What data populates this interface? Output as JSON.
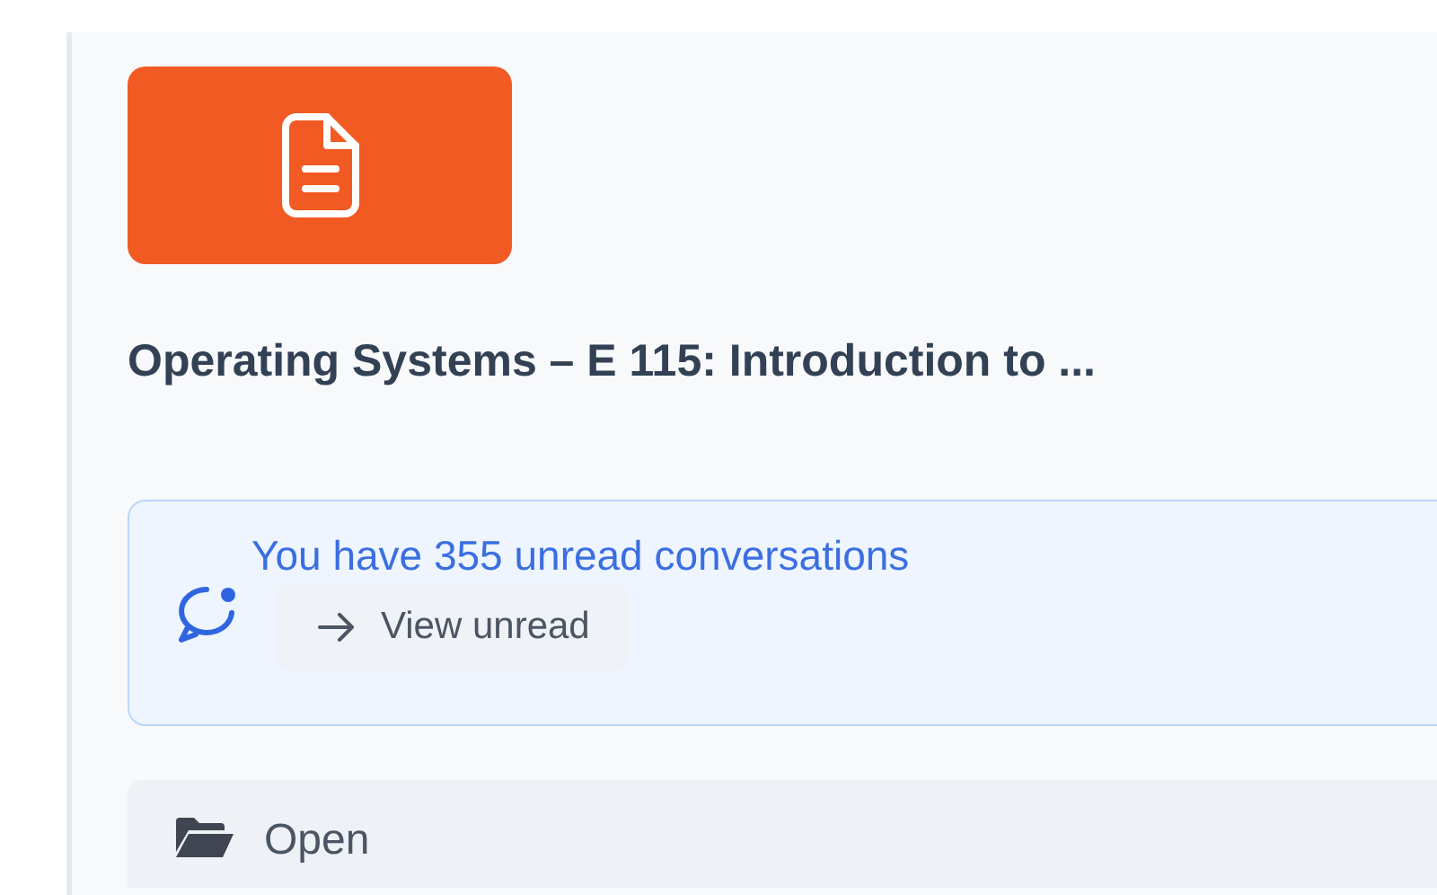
{
  "course": {
    "title": "Operating Systems – E 115: Introduction to ..."
  },
  "notice": {
    "message": "You have 355 unread conversations",
    "action": "View unread"
  },
  "open_button": {
    "label": "Open"
  }
}
